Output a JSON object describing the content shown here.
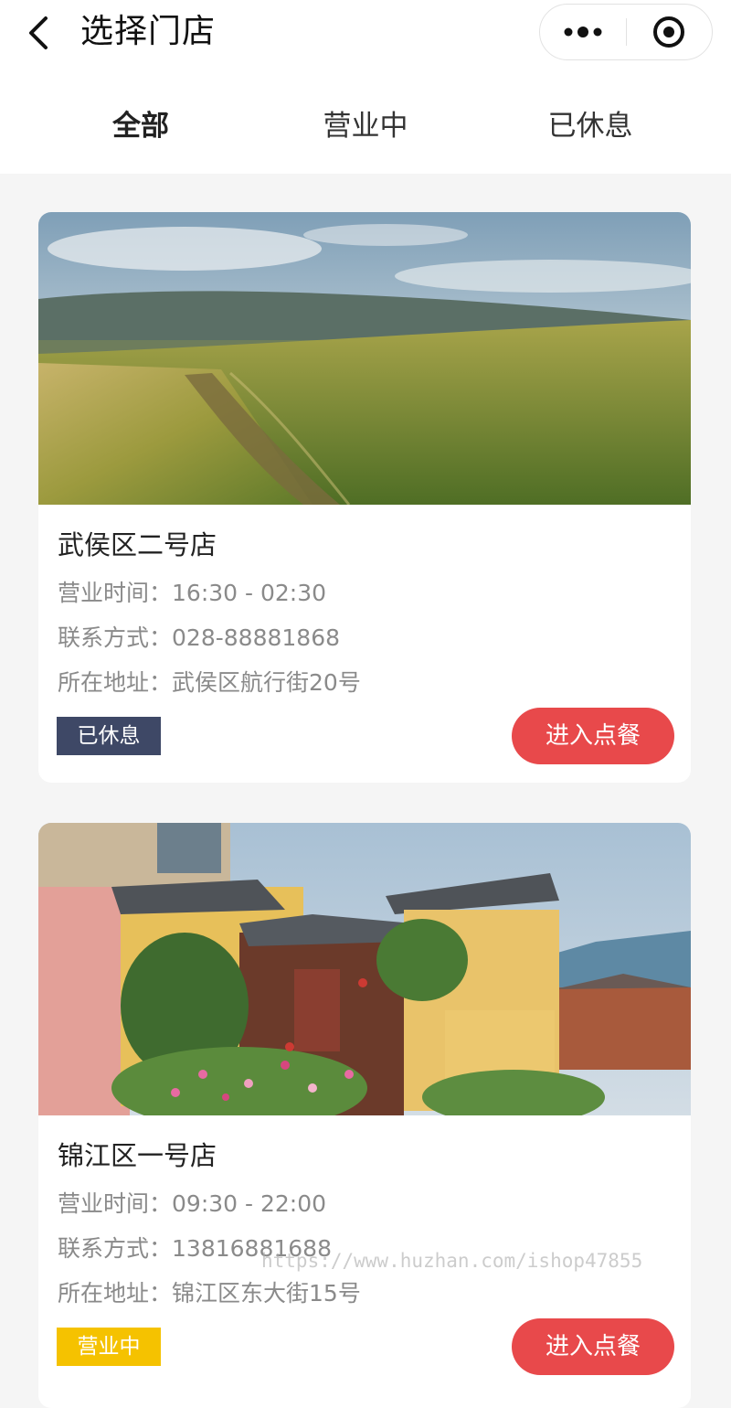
{
  "nav": {
    "title": "选择门店",
    "back_icon": "chevron-left-icon",
    "more_icon": "more-dots-icon",
    "close_icon": "record-circle-icon"
  },
  "tabs": [
    {
      "label": "全部",
      "active": true
    },
    {
      "label": "营业中",
      "active": false
    },
    {
      "label": "已休息",
      "active": false
    }
  ],
  "stores": [
    {
      "name": "武侯区二号店",
      "hours_label": "营业时间：",
      "hours": "16:30 - 02:30",
      "phone_label": "联系方式：",
      "phone": "028-88881868",
      "address_label": "所在地址：",
      "address": "武侯区航行街20号",
      "status": "已休息",
      "status_color": "#3e4866",
      "button": "进入点餐",
      "image": "wheat-field-landscape"
    },
    {
      "name": "锦江区一号店",
      "hours_label": "营业时间：",
      "hours": "09:30 - 22:00",
      "phone_label": "联系方式：",
      "phone": "13816881688",
      "address_label": "所在地址：",
      "address": "锦江区东大街15号",
      "status": "营业中",
      "status_color": "#f5c200",
      "button": "进入点餐",
      "image": "traditional-courtyard-house"
    }
  ],
  "colors": {
    "accent": "#e8494b",
    "background": "#f5f5f5"
  },
  "watermark": "https://www.huzhan.com/ishop47855"
}
